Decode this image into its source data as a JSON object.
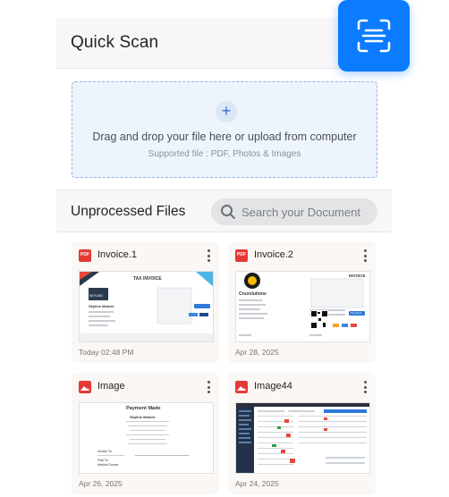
{
  "header": {
    "title": "Quick Scan",
    "scan_button_icon": "scan-frame-icon"
  },
  "dropzone": {
    "icon": "plus-icon",
    "title": "Drag and drop your file here or upload from computer",
    "subtitle": "Supported file : PDF, Photos & Images"
  },
  "files": {
    "title": "Unprocessed Files",
    "search_placeholder": "Search your Document",
    "items": [
      {
        "name": "Invoice.1",
        "type": "pdf",
        "date": "Today 02:48 PM",
        "preview": {
          "doc_title": "TAX INVOICE",
          "brand": "SKYLINE",
          "company": "Skyline Motors"
        }
      },
      {
        "name": "Invoice.2",
        "type": "pdf",
        "date": "Apr 28, 2025",
        "preview": {
          "doc_title": "INVOICE",
          "company": "Cruxolutions",
          "pay_label": "Pay Now"
        }
      },
      {
        "name": "Image",
        "type": "image",
        "date": "Apr 26, 2025",
        "preview": {
          "doc_title": "Payment Made",
          "company": "Skyline Motors",
          "to_label": "Invoice To:",
          "paid_label": "Paid To:",
          "payee": "Marlow Gomez"
        }
      },
      {
        "name": "Image44",
        "type": "image",
        "date": "Apr 24, 2025",
        "preview": {}
      }
    ]
  },
  "colors": {
    "accent": "#0b7cff",
    "pdf_red": "#e53935",
    "image_red": "#e53935"
  }
}
